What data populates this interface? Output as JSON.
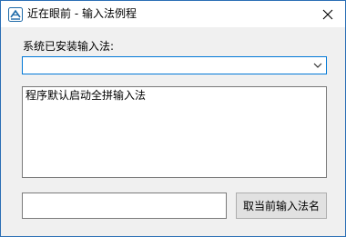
{
  "window": {
    "title": "近在眼前 - 输入法例程",
    "icon": "app-logo-icon",
    "close_icon": "close-icon",
    "accent_color": "#0078d7"
  },
  "main": {
    "installed_label": "系统已安装输入法:",
    "installed_combo_value": "",
    "log_text": "程序默认启动全拼输入法",
    "current_ime_value": "",
    "get_ime_button_label": "取当前输入法名"
  }
}
